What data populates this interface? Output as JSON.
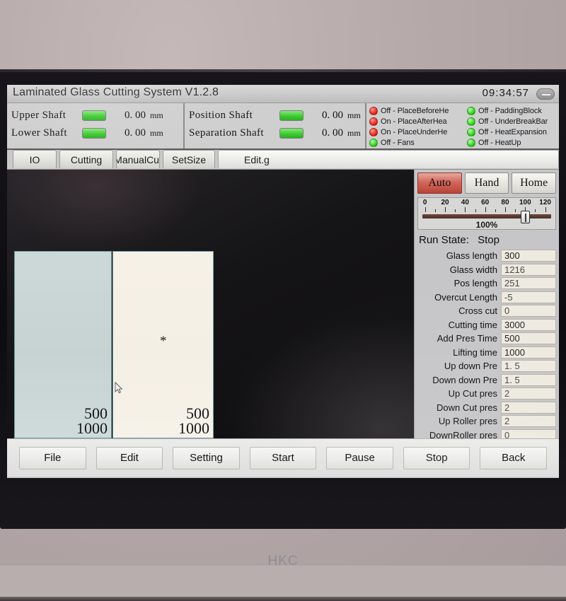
{
  "window": {
    "title": "Laminated Glass Cutting System  V1.2.8",
    "clock": "09:34:57",
    "minimize_icon": "minimize-icon"
  },
  "shafts": {
    "left_group": [
      {
        "label": "Upper Shaft",
        "value": "0. 00",
        "unit": "mm",
        "lamp": "#3fcc32"
      },
      {
        "label": "Lower Shaft",
        "value": "0. 00",
        "unit": "mm",
        "lamp": "#3fcc32"
      }
    ],
    "right_group": [
      {
        "label": "Position Shaft",
        "value": "0. 00",
        "unit": "mm",
        "lamp": "#3fcc32"
      },
      {
        "label": "Separation Shaft",
        "value": "0. 00",
        "unit": "mm",
        "lamp": "#3fcc32"
      }
    ]
  },
  "io_indicators": {
    "column_a": [
      {
        "state": "Off",
        "name": "PlaceBeforeHe",
        "text": "Off - PlaceBeforeHe",
        "led": "green"
      },
      {
        "state": "On",
        "name": "PlaceAfterHea",
        "text": "On - PlaceAfterHea",
        "led": "red"
      },
      {
        "state": "On",
        "name": "PlaceUnderHe",
        "text": "On - PlaceUnderHe",
        "led": "red"
      },
      {
        "state": "Off",
        "name": "Fans",
        "text": "Off - Fans",
        "led": "green"
      }
    ],
    "column_b": [
      {
        "state": "Off",
        "name": "PaddingBlock",
        "text": "Off - PaddingBlock",
        "led": "green"
      },
      {
        "state": "Off",
        "name": "UnderBreakBar",
        "text": "Off - UnderBreakBar",
        "led": "green"
      },
      {
        "state": "Off",
        "name": "HeatExpansion",
        "text": "Off - HeatExpansion",
        "led": "green"
      },
      {
        "state": "Off",
        "name": "HeatUp",
        "text": "Off - HeatUp",
        "led": "green"
      }
    ]
  },
  "tabs": [
    {
      "label": "IO",
      "selected": false
    },
    {
      "label": "Cutting",
      "selected": false
    },
    {
      "label": "ManualCut",
      "selected": false
    },
    {
      "label": "SetSize",
      "selected": false
    },
    {
      "label": "Edit.g",
      "selected": true
    }
  ],
  "canvas": {
    "panes": [
      {
        "id": "left",
        "dim_top": "500",
        "dim_bottom": "1000",
        "fill": "#c9d7d6",
        "mark": ""
      },
      {
        "id": "right",
        "dim_top": "500",
        "dim_bottom": "1000",
        "fill": "#f5f0e6",
        "mark": "*"
      }
    ],
    "cursor_icon": "mouse-pointer-icon"
  },
  "modes": [
    {
      "label": "Auto",
      "active": true
    },
    {
      "label": "Hand",
      "active": false
    },
    {
      "label": "Home",
      "active": false
    }
  ],
  "slider": {
    "ticks": [
      0,
      20,
      40,
      60,
      80,
      100,
      120
    ],
    "min": 0,
    "max": 120,
    "value": 100,
    "percent_label": "100%"
  },
  "run_state": {
    "label": "Run State:",
    "value": "Stop"
  },
  "parameters": [
    {
      "label": "Glass length",
      "value": "300"
    },
    {
      "label": "Glass width",
      "value": "1216"
    },
    {
      "label": "Pos length",
      "value": "251"
    },
    {
      "label": "Overcut Length",
      "value": "-5"
    },
    {
      "label": "Cross cut",
      "value": "0"
    },
    {
      "label": "Cutting time",
      "value": "3000"
    },
    {
      "label": "Add Pres Time",
      "value": "500"
    },
    {
      "label": "Lifting time",
      "value": "1000"
    },
    {
      "label": "Up down Pre",
      "value": "1. 5"
    },
    {
      "label": "Down down Pre",
      "value": "1. 5"
    },
    {
      "label": "Up Cut pres",
      "value": "2"
    },
    {
      "label": "Down Cut pres",
      "value": "2"
    },
    {
      "label": "Up Roller pres",
      "value": "2"
    },
    {
      "label": "DownRoller pres",
      "value": "0"
    }
  ],
  "toolbar": [
    {
      "label": "File"
    },
    {
      "label": "Edit"
    },
    {
      "label": "Setting"
    },
    {
      "label": "Start"
    },
    {
      "label": "Pause"
    },
    {
      "label": "Stop"
    },
    {
      "label": "Back"
    }
  ],
  "monitor": {
    "brand": "HKC"
  }
}
